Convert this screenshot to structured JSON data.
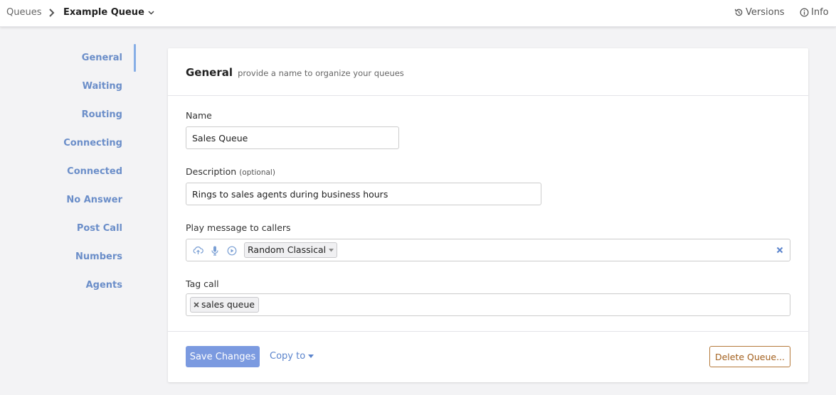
{
  "breadcrumb": {
    "root": "Queues",
    "current": "Example Queue"
  },
  "top_actions": {
    "versions": "Versions",
    "info": "Info"
  },
  "sidebar": {
    "items": [
      {
        "label": "General",
        "active": true
      },
      {
        "label": "Waiting"
      },
      {
        "label": "Routing"
      },
      {
        "label": "Connecting"
      },
      {
        "label": "Connected"
      },
      {
        "label": "No Answer"
      },
      {
        "label": "Post Call"
      },
      {
        "label": "Numbers"
      },
      {
        "label": "Agents"
      }
    ]
  },
  "section": {
    "title": "General",
    "subtitle": "provide a name to organize your queues"
  },
  "form": {
    "name_label": "Name",
    "name_value": "Sales Queue",
    "description_label": "Description",
    "description_optional": "(optional)",
    "description_value": "Rings to sales agents during business hours",
    "message_label": "Play message to callers",
    "message_selected": "Random Classical",
    "tag_label": "Tag call",
    "tags": [
      "sales queue"
    ]
  },
  "footer": {
    "save_label": "Save Changes",
    "copy_label": "Copy to",
    "delete_label": "Delete Queue..."
  },
  "colors": {
    "accent": "#7b9ae0",
    "link": "#5b84cc",
    "danger": "#a3611f"
  },
  "icons": {
    "breadcrumb_separator": "chevron-right-icon",
    "dropdown": "chevron-down-icon",
    "versions": "history-icon",
    "info": "info-icon",
    "upload": "cloud-upload-icon",
    "record": "microphone-icon",
    "play": "play-icon",
    "clear": "close-icon"
  }
}
